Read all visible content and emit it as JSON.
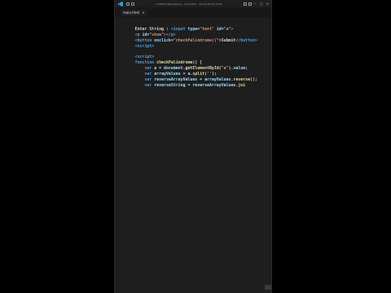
{
  "window": {
    "title": "Untitled (Workspace) - main.html - Visual Studio Code"
  },
  "tab": {
    "label": "main.html",
    "close": "×"
  },
  "controls": {
    "minimize": "—",
    "maximize": "□",
    "close": "✕"
  },
  "code": {
    "l1": [
      "Enter String : ",
      "<input ",
      "type=",
      "\"text\" ",
      "id=",
      "\"a\"",
      ">"
    ],
    "l2": [
      "<p ",
      "id=",
      "\"show\"",
      "></p>"
    ],
    "l3": [
      "<button ",
      "onclick=",
      "\"checkPalindrome()\"",
      ">Submit",
      "</button>"
    ],
    "l4": [
      "<script>"
    ],
    "l5": [
      "<script>"
    ],
    "l6": [
      "function ",
      "checkPalindrome",
      "() {"
    ],
    "l7": [
      "    var ",
      "a",
      " = ",
      "document",
      ".",
      "getElementById",
      "(",
      "\"a\"",
      ").",
      "value",
      ";"
    ],
    "l8": [
      "    var ",
      "arrayValues",
      " = ",
      "a",
      ".",
      "split",
      "(",
      "''",
      ");"
    ],
    "l9": [
      "    var ",
      "reverseArrayValues",
      " = ",
      "arrayValues",
      ".",
      "reverse",
      "();"
    ],
    "l10": [
      "    var ",
      "reverseString",
      " = ",
      "reverseArrayValues",
      ".",
      "joi"
    ]
  },
  "colors": {
    "background": "#1e1e1e",
    "keyword": "#569cd6",
    "attribute": "#9cdcfe",
    "string": "#ce9178",
    "function": "#dcdcaa",
    "text": "#d4d4d4"
  }
}
